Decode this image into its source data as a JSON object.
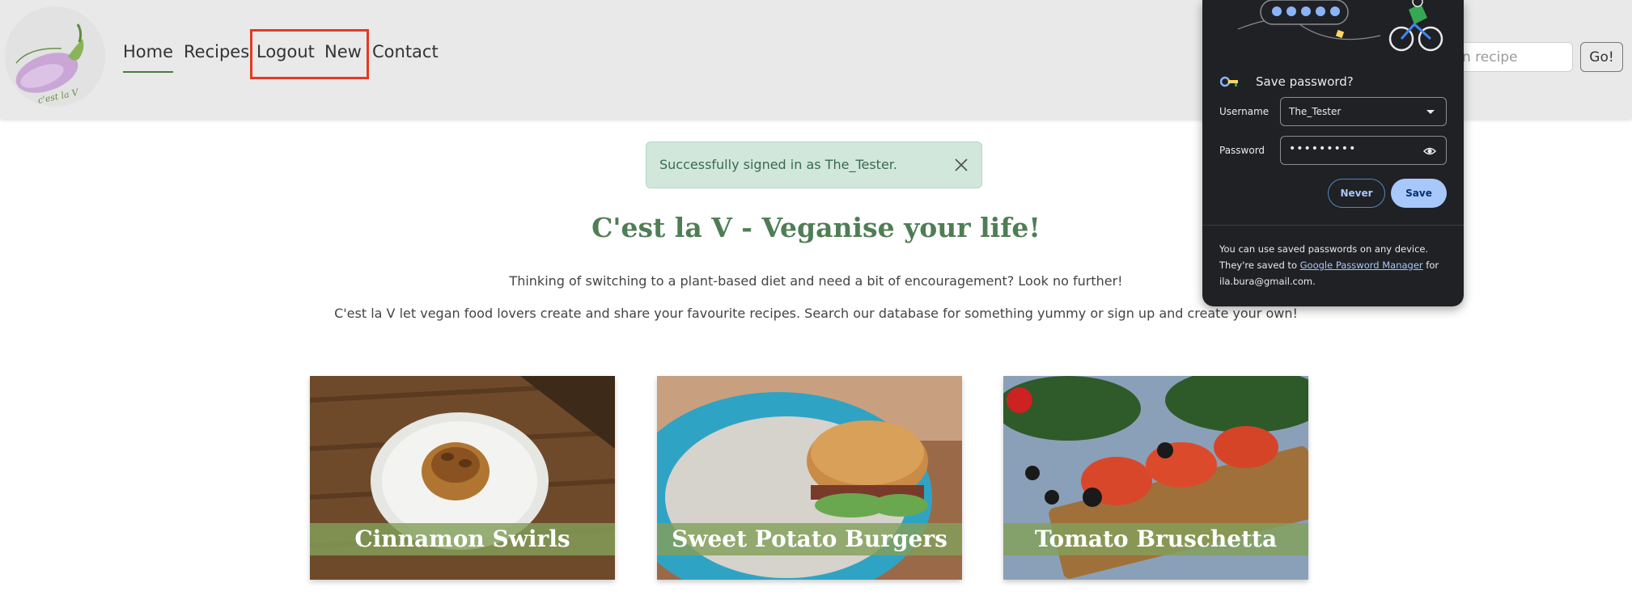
{
  "nav": {
    "logo_text": "c'est la V",
    "links": [
      {
        "label": "Home"
      },
      {
        "label": "Recipes"
      },
      {
        "label": "Logout"
      },
      {
        "label": "New"
      },
      {
        "label": "Contact"
      }
    ],
    "search": {
      "placeholder": "n recipe",
      "button_label": "Go!"
    }
  },
  "alert": {
    "text": "Successfully signed in as The_Tester."
  },
  "hero": {
    "title": "C'est la V - Veganise your life!",
    "line1": "Thinking of switching to a plant-based diet and need a bit of encouragement? Look no further!",
    "line2": "C'est la V let vegan food lovers create and share your favourite recipes. Search our database for something yummy or sign up and create your own!"
  },
  "cards": [
    {
      "title": "Cinnamon Swirls"
    },
    {
      "title": "Sweet Potato Burgers"
    },
    {
      "title": "Tomato Bruschetta"
    }
  ],
  "password_popup": {
    "title": "Save password?",
    "username_label": "Username",
    "username_value": "The_Tester",
    "password_label": "Password",
    "password_value": "•••••••••",
    "never_label": "Never",
    "save_label": "Save",
    "footer_pre": "You can use saved passwords on any device. They're saved to ",
    "footer_link": "Google Password Manager",
    "footer_post": " for ila.bura@gmail.com."
  },
  "colors": {
    "accent": "#4f7d54",
    "alert_bg": "#d1e7dc",
    "popup_bg": "#202124",
    "highlight": "#e53a21",
    "card_label_bg": "#82a05a"
  }
}
